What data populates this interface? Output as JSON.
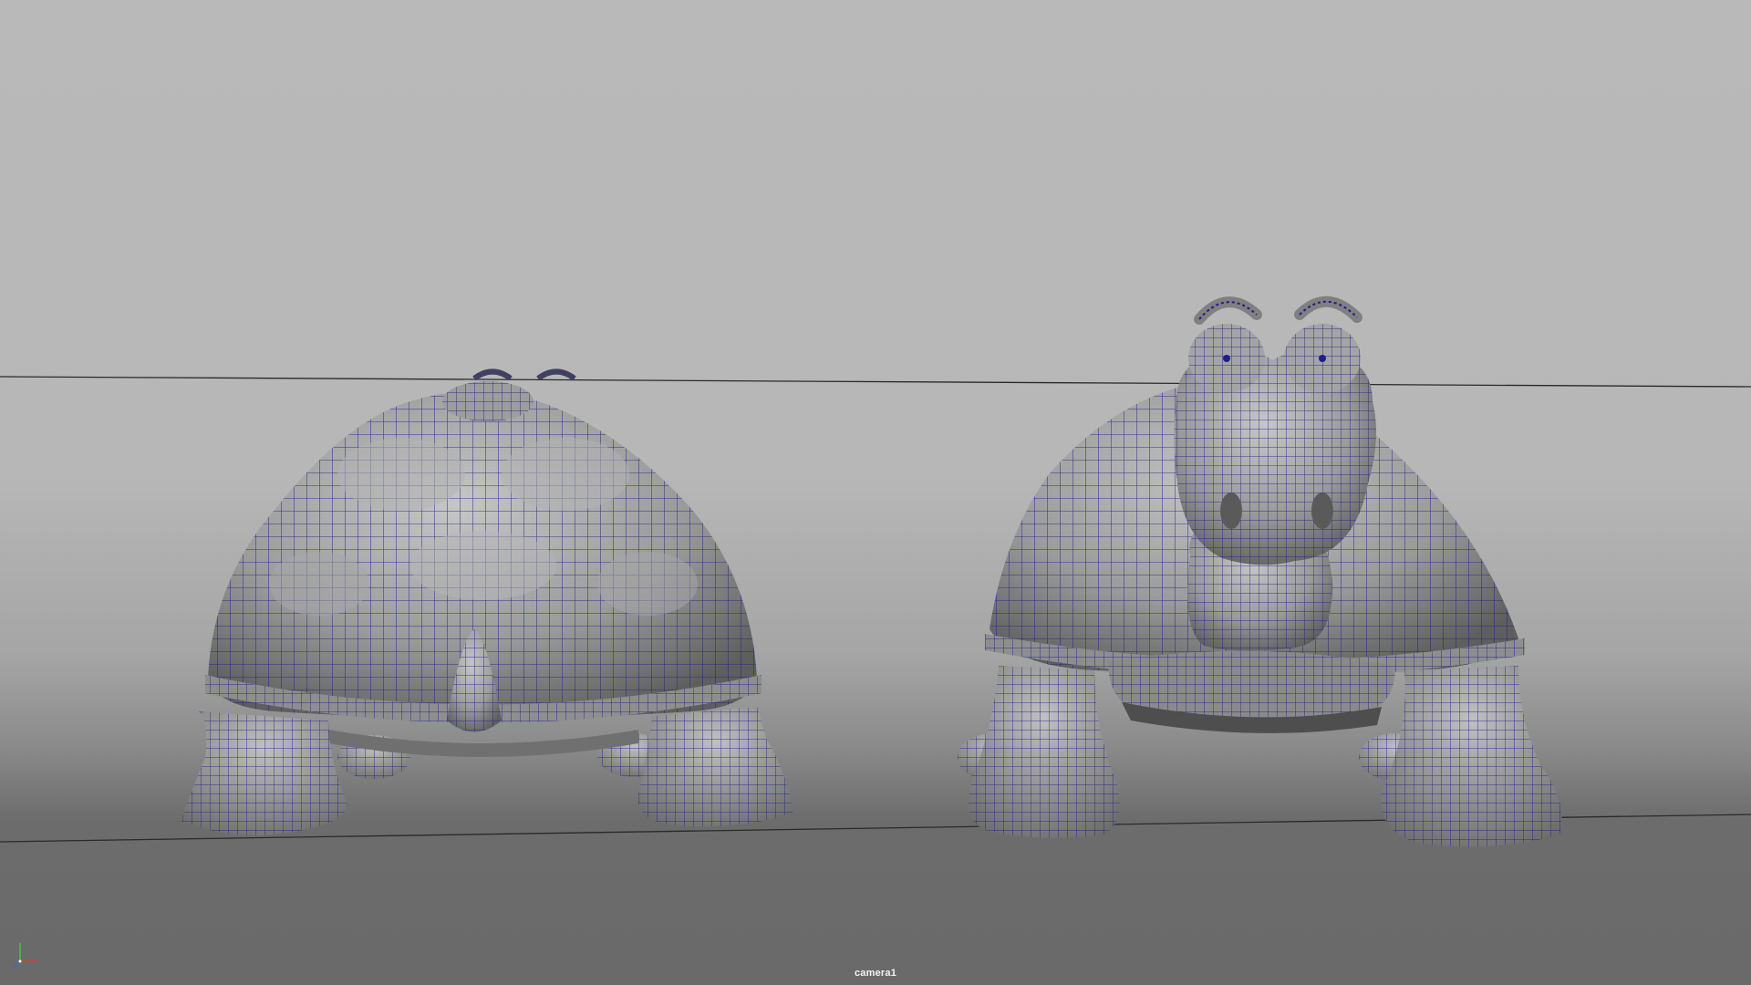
{
  "viewport": {
    "camera_name": "camera1",
    "background_top": "#b9b9b9",
    "background_bottom": "#6a6a6a",
    "wireframe_color": "#1e1e8c",
    "mesh_shade": "#9c9c9c"
  },
  "objects": [
    {
      "name": "turtle-back-view",
      "view": "back"
    },
    {
      "name": "turtle-front-view",
      "view": "front"
    }
  ],
  "axis_indicator": {
    "icon": "xyz-axis-icon",
    "x_color": "#d23c3c",
    "y_color": "#3cc83c",
    "z_color": "#3c64dc"
  }
}
